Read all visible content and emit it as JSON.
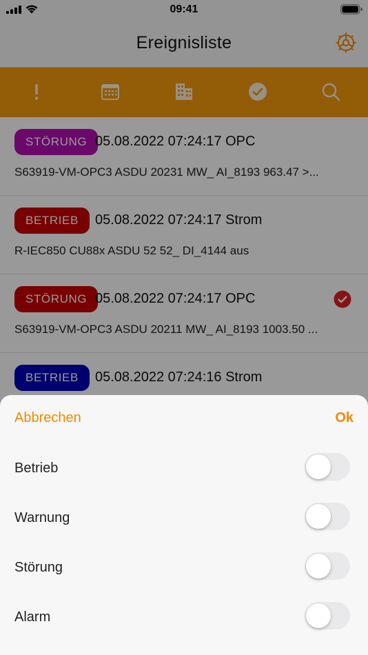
{
  "status": {
    "time": "09:41"
  },
  "nav": {
    "title": "Ereignisliste",
    "settings_icon": "gear-icon"
  },
  "toolbar": {
    "bg": "#f59a0c",
    "icons": [
      "exclamation-icon",
      "calendar-icon",
      "building-icon",
      "checkmark-circle-icon",
      "search-icon"
    ]
  },
  "events": [
    {
      "badge": "STÖRUNG",
      "badge_color": "#b10fb1",
      "head": "05.08.2022 07:24:17 OPC",
      "text": "S63919-VM-OPC3 ASDU 20231 MW_ AI_8193 963.47 >...",
      "checked": false
    },
    {
      "badge": "BETRIEB",
      "badge_color": "#c80000",
      "head": "05.08.2022 07:24:17 Strom",
      "text": "R-IEC850 CU88x ASDU 52 52_ DI_4144 aus",
      "checked": false
    },
    {
      "badge": "STÖRUNG",
      "badge_color": "#c80000",
      "head": "05.08.2022 07:24:17 OPC",
      "text": "S63919-VM-OPC3 ASDU 20211 MW_ AI_8193 1003.50 ...",
      "checked": true
    },
    {
      "badge": "BETRIEB",
      "badge_color": "#0000b8",
      "head": "05.08.2022 07:24:16 Strom",
      "text": "",
      "checked": false
    }
  ],
  "sheet": {
    "cancel_label": "Abbrechen",
    "ok_label": "Ok",
    "accent": "#f08a00",
    "options": [
      {
        "label": "Betrieb",
        "on": false
      },
      {
        "label": "Warnung",
        "on": false
      },
      {
        "label": "Störung",
        "on": false
      },
      {
        "label": "Alarm",
        "on": false
      }
    ]
  }
}
